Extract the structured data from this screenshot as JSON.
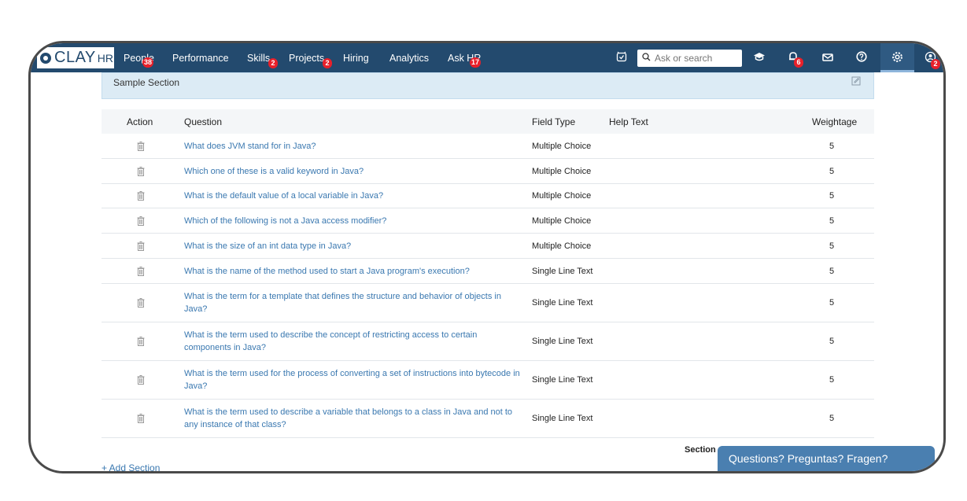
{
  "brand": {
    "name": "CLAY",
    "suffix": "HR"
  },
  "nav": [
    {
      "label": "People",
      "badge": "38"
    },
    {
      "label": "Performance",
      "badge": ""
    },
    {
      "label": "Skills",
      "badge": "2"
    },
    {
      "label": "Projects",
      "badge": "2"
    },
    {
      "label": "Hiring",
      "badge": ""
    },
    {
      "label": "Analytics",
      "badge": ""
    },
    {
      "label": "Ask HR",
      "badge": "17"
    }
  ],
  "search": {
    "placeholder": "Ask or search"
  },
  "icons": {
    "notifications_badge": "6",
    "profile_badge": "2"
  },
  "section": {
    "title": "Sample Section"
  },
  "table": {
    "headers": {
      "action": "Action",
      "question": "Question",
      "field_type": "Field Type",
      "help_text": "Help Text",
      "weightage": "Weightage"
    },
    "rows": [
      {
        "question": "What does JVM stand for in Java?",
        "field_type": "Multiple Choice",
        "weightage": "5"
      },
      {
        "question": "Which one of these is a valid keyword in Java?",
        "field_type": "Multiple Choice",
        "weightage": "5"
      },
      {
        "question": "What is the default value of a local variable in Java?",
        "field_type": "Multiple Choice",
        "weightage": "5"
      },
      {
        "question": "Which of the following is not a Java access modifier?",
        "field_type": "Multiple Choice",
        "weightage": "5"
      },
      {
        "question": "What is the size of an int data type in Java?",
        "field_type": "Multiple Choice",
        "weightage": "5"
      },
      {
        "question": "What is the name of the method used to start a Java program's execution?",
        "field_type": "Single Line Text",
        "weightage": "5"
      },
      {
        "question": "What is the term for a template that defines the structure and behavior of objects in Java?",
        "field_type": "Single Line Text",
        "weightage": "5"
      },
      {
        "question": "What is the term used to describe the concept of restricting access to certain components in Java?",
        "field_type": "Single Line Text",
        "weightage": "5"
      },
      {
        "question": "What is the term used for the process of converting a set of instructions into bytecode in Java?",
        "field_type": "Single Line Text",
        "weightage": "5"
      },
      {
        "question": "What is the term used to describe a variable that belongs to a class in Java and not to any instance of that class?",
        "field_type": "Single Line Text",
        "weightage": "5"
      }
    ]
  },
  "footer": {
    "section_label": "Section",
    "add_section": "+ Add Section"
  },
  "chat": {
    "label": "Questions? Preguntas? Fragen?"
  }
}
